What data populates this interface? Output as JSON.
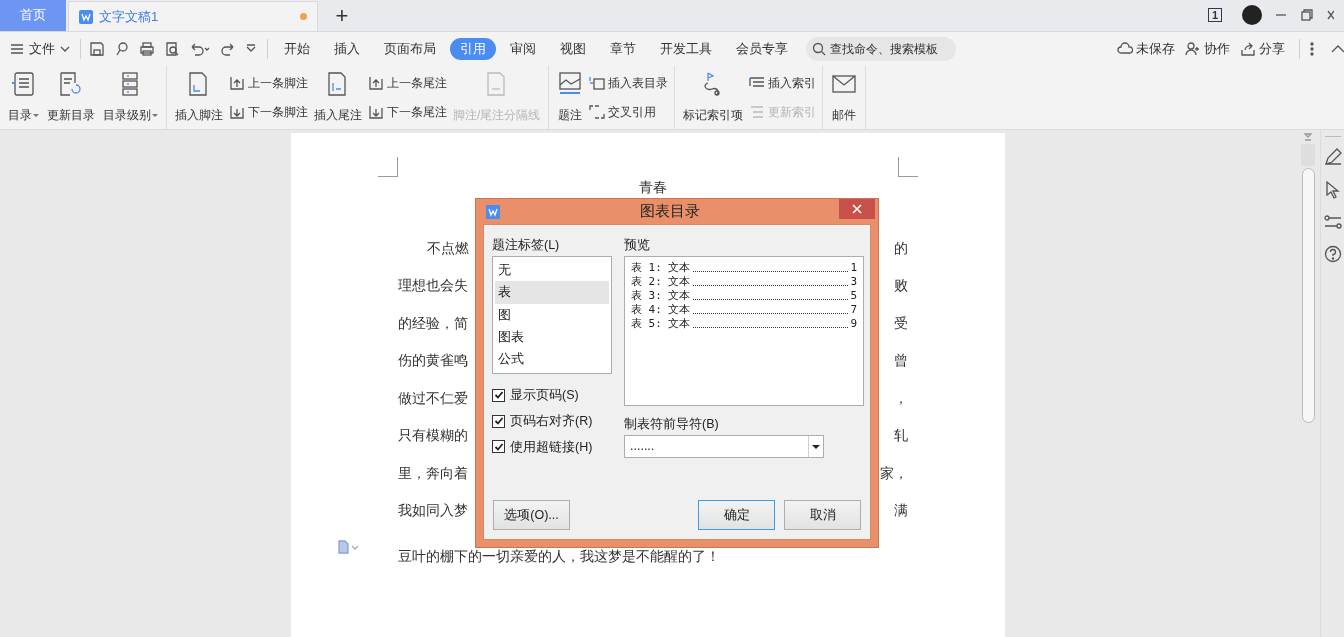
{
  "tabs": [
    {
      "label": "首页",
      "kind": "home",
      "selected": false
    },
    {
      "label": "文字文稿1",
      "kind": "doc",
      "selected": true,
      "unsaved": true
    }
  ],
  "new_tab": "+",
  "title_bar": {
    "page_count": "1"
  },
  "menu": {
    "file": "文件",
    "ribbon_tabs": [
      {
        "label": "开始",
        "selected": false
      },
      {
        "label": "插入",
        "selected": false
      },
      {
        "label": "页面布局",
        "selected": false
      },
      {
        "label": "引用",
        "selected": true
      },
      {
        "label": "审阅",
        "selected": false
      },
      {
        "label": "视图",
        "selected": false
      },
      {
        "label": "章节",
        "selected": false
      },
      {
        "label": "开发工具",
        "selected": false
      },
      {
        "label": "会员专享",
        "selected": false
      }
    ],
    "search": {
      "placeholder": "查找命令、搜索模板"
    },
    "actions": [
      "未保存",
      "协作",
      "分享"
    ]
  },
  "ribbon": {
    "groups": [
      {
        "items": [
          {
            "kind": "large",
            "label": "目录",
            "dropdown": true,
            "disabled": false
          },
          {
            "kind": "large",
            "label": "更新目录",
            "dropdown": false,
            "disabled": false
          },
          {
            "kind": "large",
            "label": "目录级别",
            "dropdown": true,
            "disabled": false
          }
        ]
      },
      {
        "items": [
          {
            "kind": "large",
            "label": "插入脚注",
            "dropdown": false,
            "disabled": false
          },
          {
            "kind": "stack",
            "children": [
              {
                "label": "上一条脚注",
                "disabled": false
              },
              {
                "label": "下一条脚注",
                "disabled": false
              }
            ]
          },
          {
            "kind": "large",
            "label": "插入尾注",
            "dropdown": false,
            "disabled": false
          },
          {
            "kind": "stack",
            "children": [
              {
                "label": "上一条尾注",
                "disabled": false
              },
              {
                "label": "下一条尾注",
                "disabled": false
              }
            ]
          },
          {
            "kind": "large",
            "label": "脚注/尾注分隔线",
            "dropdown": false,
            "disabled": true
          }
        ]
      },
      {
        "items": [
          {
            "kind": "large",
            "label": "题注",
            "dropdown": false,
            "disabled": false
          },
          {
            "kind": "stack",
            "children": [
              {
                "label": "插入表目录",
                "disabled": false
              },
              {
                "label": "交叉引用",
                "disabled": false
              }
            ]
          }
        ]
      },
      {
        "items": [
          {
            "kind": "large",
            "label": "标记索引项",
            "dropdown": false,
            "disabled": false
          },
          {
            "kind": "stack",
            "children": [
              {
                "label": "插入索引",
                "disabled": false
              },
              {
                "label": "更新索引",
                "disabled": true
              }
            ]
          }
        ]
      },
      {
        "items": [
          {
            "kind": "large",
            "label": "邮件",
            "dropdown": false,
            "disabled": false
          }
        ]
      }
    ]
  },
  "document": {
    "title": "青春",
    "lines": [
      {
        "left": "不点燃",
        "right": "的",
        "indent": true
      },
      {
        "left": "理想也会失",
        "right": "败",
        "indent": false
      },
      {
        "left": "的经验，简",
        "right": "受",
        "indent": false
      },
      {
        "left": "伤的黄雀鸣",
        "right": "曾",
        "indent": false
      },
      {
        "left": "做过不仁爱",
        "right": "，",
        "indent": false
      },
      {
        "left": "只有模糊的",
        "right": "轧",
        "indent": false
      },
      {
        "left": "里，奔向着",
        "right": "家，",
        "indent": false
      },
      {
        "left": "我如同入梦",
        "right": "满",
        "indent": false
      }
    ],
    "last_line": "豆叶的棚下的一切亲爱的人，我这梦是不能醒的了！"
  },
  "dialog": {
    "title": "图表目录",
    "caption_label": "题注标签(L)",
    "captions": [
      {
        "label": "无",
        "selected": false
      },
      {
        "label": "表",
        "selected": true
      },
      {
        "label": "图",
        "selected": false
      },
      {
        "label": "图表",
        "selected": false
      },
      {
        "label": "公式",
        "selected": false
      }
    ],
    "checkboxes": [
      {
        "label": "显示页码(S)",
        "checked": true
      },
      {
        "label": "页码右对齐(R)",
        "checked": true
      },
      {
        "label": "使用超链接(H)",
        "checked": true
      }
    ],
    "preview_label": "预览",
    "preview": [
      {
        "label": "表 1: 文本",
        "page": "1"
      },
      {
        "label": "表 2: 文本",
        "page": "3"
      },
      {
        "label": "表 3: 文本",
        "page": "5"
      },
      {
        "label": "表 4: 文本",
        "page": "7"
      },
      {
        "label": "表 5: 文本",
        "page": "9"
      }
    ],
    "leader_label": "制表符前导符(B)",
    "leader_value": ".......",
    "buttons": [
      {
        "label": "选项(O)...",
        "kind": "options",
        "default": false
      },
      {
        "label": "确定",
        "kind": "ok",
        "default": true
      },
      {
        "label": "取消",
        "kind": "cancel",
        "default": false
      }
    ]
  }
}
